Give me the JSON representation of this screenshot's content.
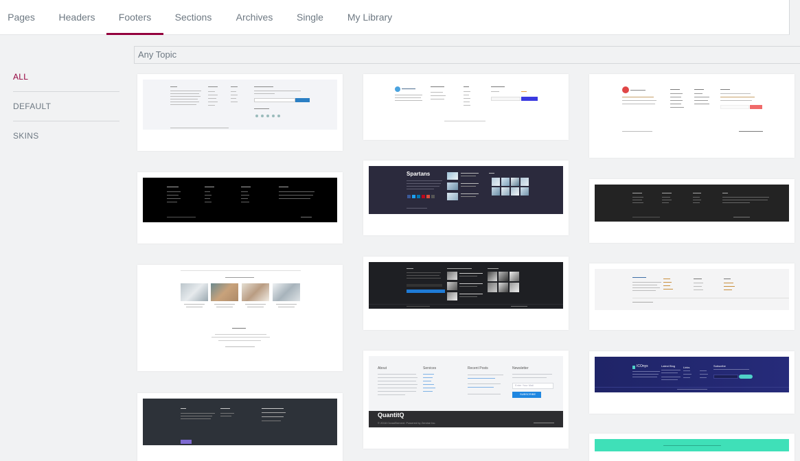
{
  "tabs": [
    {
      "label": "Pages"
    },
    {
      "label": "Headers"
    },
    {
      "label": "Footers"
    },
    {
      "label": "Sections"
    },
    {
      "label": "Archives"
    },
    {
      "label": "Single"
    },
    {
      "label": "My Library"
    }
  ],
  "active_tab": "Footers",
  "topic_select": {
    "value": "Any Topic"
  },
  "sidebar": {
    "items": [
      {
        "label": "ALL"
      },
      {
        "label": "DEFAULT"
      },
      {
        "label": "SKINS"
      }
    ],
    "active": "ALL"
  },
  "templates": {
    "c1": {
      "brand": "Spartans"
    },
    "c2": {
      "brand": "QuantitQ",
      "about": "About",
      "services": "Services",
      "recent": "Recent Posts",
      "newsletter": "Newsletter",
      "subscribe": "SUBSCRIBE",
      "email_placeholder": "Enter Your Mail",
      "copyright": "© 2018 CrossElement. Powered by Zenrise Inc."
    },
    "c3": {
      "brand": "ICOnyx",
      "blog": "Latest Blog",
      "links": "Links",
      "subscribe": "Subscribe"
    }
  },
  "colors": {
    "accent": "#93003c",
    "page_bg": "#f1f2f3"
  }
}
